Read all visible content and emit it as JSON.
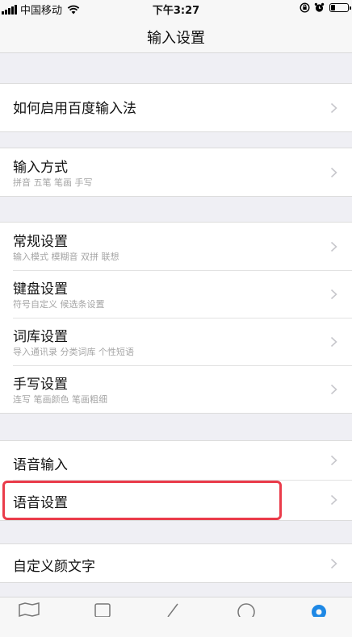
{
  "status_bar": {
    "carrier": "中国移动",
    "time": "下午3:27",
    "battery_level": 0.25
  },
  "nav": {
    "title": "输入设置"
  },
  "sections": [
    {
      "rows": [
        {
          "label": "如何启用百度输入法"
        }
      ]
    },
    {
      "rows": [
        {
          "label": "输入方式",
          "sub": "拼音 五笔 笔画 手写"
        }
      ]
    },
    {
      "rows": [
        {
          "label": "常规设置",
          "sub": "输入模式 模糊音 双拼 联想"
        },
        {
          "label": "键盘设置",
          "sub": "符号自定义 候选条设置"
        },
        {
          "label": "词库设置",
          "sub": "导入通讯录 分类词库 个性短语"
        },
        {
          "label": "手写设置",
          "sub": "连写 笔画颜色 笔画粗细"
        }
      ]
    },
    {
      "rows": [
        {
          "label": "语音输入"
        },
        {
          "label": "语音设置"
        }
      ]
    },
    {
      "rows": [
        {
          "label": "自定义颜文字"
        }
      ]
    }
  ],
  "colors": {
    "highlight": "#ea3b4a",
    "accent": "#1e88e5",
    "chevron": "#c7c7cc"
  },
  "tab_bar": {
    "icons": [
      "map-icon",
      "calendar-icon",
      "pen-icon",
      "chat-icon",
      "gear-icon"
    ]
  }
}
